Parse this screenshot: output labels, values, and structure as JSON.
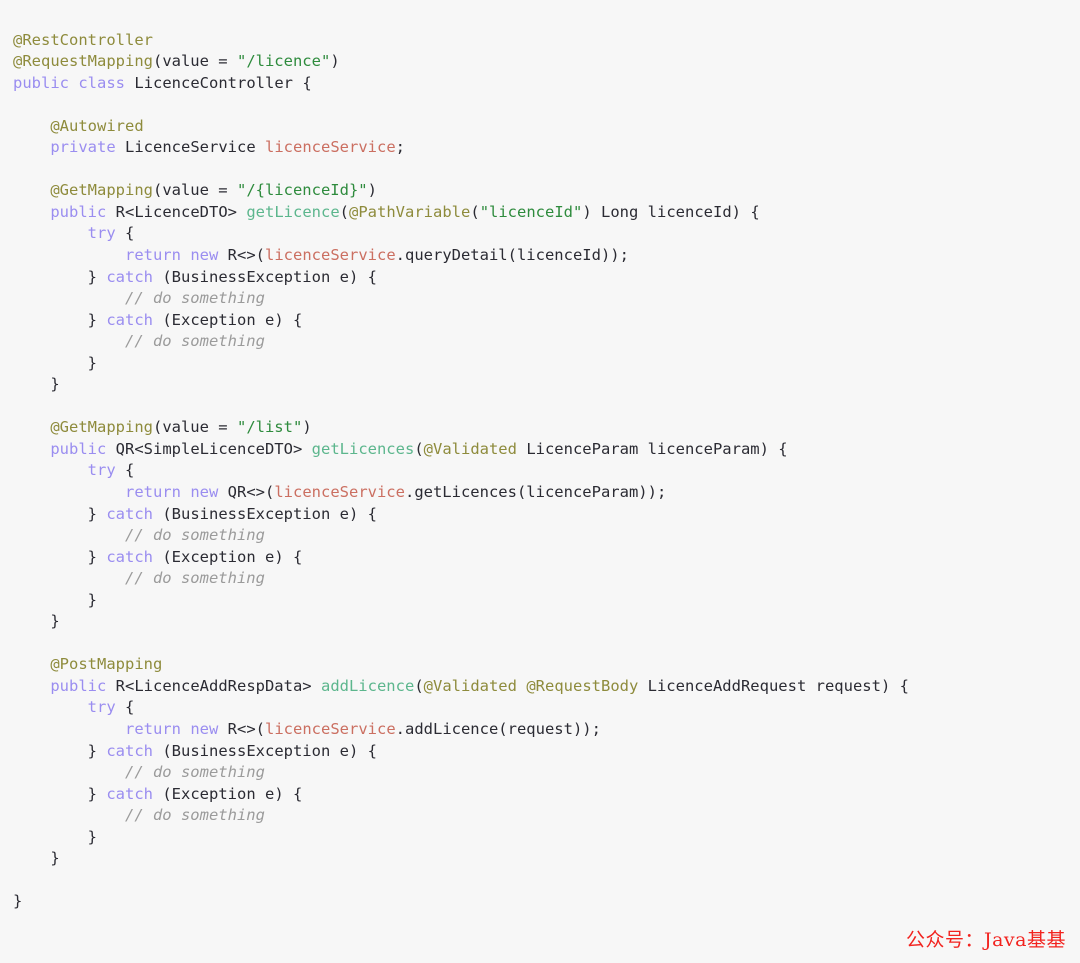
{
  "viewer": {
    "name": "java-code-snippet",
    "language": "Java",
    "background_color": "#f7f7f7",
    "default_text_color": "#2b2b33"
  },
  "theme": {
    "annotation_color": "#8e8b3c",
    "keyword_color": "#9a8df0",
    "string_color": "#2e8b3d",
    "field_color": "#cb6f61",
    "method_color": "#5cb68d",
    "class_color": "#2b2b33",
    "comment_color": "#9b9b9b",
    "watermark_color": "#f2231f"
  },
  "watermark": {
    "text": "公众号：Java基基"
  },
  "code": {
    "lines": [
      [
        {
          "t": "@RestController",
          "c": "ann"
        }
      ],
      [
        {
          "t": "@RequestMapping",
          "c": "ann"
        },
        {
          "t": "(value = ",
          "c": "pln"
        },
        {
          "t": "\"/licence\"",
          "c": "str"
        },
        {
          "t": ")",
          "c": "pln"
        }
      ],
      [
        {
          "t": "public",
          "c": "kw"
        },
        {
          "t": " ",
          "c": "pln"
        },
        {
          "t": "class",
          "c": "kw"
        },
        {
          "t": " ",
          "c": "pln"
        },
        {
          "t": "LicenceController",
          "c": "cls"
        },
        {
          "t": " {",
          "c": "pln"
        }
      ],
      [],
      [
        {
          "t": "    ",
          "c": "pln"
        },
        {
          "t": "@Autowired",
          "c": "ann"
        }
      ],
      [
        {
          "t": "    ",
          "c": "pln"
        },
        {
          "t": "private",
          "c": "kw"
        },
        {
          "t": " ",
          "c": "pln"
        },
        {
          "t": "LicenceService",
          "c": "cls"
        },
        {
          "t": " ",
          "c": "pln"
        },
        {
          "t": "licenceService",
          "c": "fld"
        },
        {
          "t": ";",
          "c": "pln"
        }
      ],
      [],
      [
        {
          "t": "    ",
          "c": "pln"
        },
        {
          "t": "@GetMapping",
          "c": "ann"
        },
        {
          "t": "(value = ",
          "c": "pln"
        },
        {
          "t": "\"/{licenceId}\"",
          "c": "str"
        },
        {
          "t": ")",
          "c": "pln"
        }
      ],
      [
        {
          "t": "    ",
          "c": "pln"
        },
        {
          "t": "public",
          "c": "kw"
        },
        {
          "t": " ",
          "c": "pln"
        },
        {
          "t": "R<LicenceDTO>",
          "c": "cls"
        },
        {
          "t": " ",
          "c": "pln"
        },
        {
          "t": "getLicence",
          "c": "mth"
        },
        {
          "t": "(",
          "c": "pln"
        },
        {
          "t": "@PathVariable",
          "c": "ann"
        },
        {
          "t": "(",
          "c": "pln"
        },
        {
          "t": "\"licenceId\"",
          "c": "str"
        },
        {
          "t": ") Long licenceId) {",
          "c": "pln"
        }
      ],
      [
        {
          "t": "        ",
          "c": "pln"
        },
        {
          "t": "try",
          "c": "kw"
        },
        {
          "t": " {",
          "c": "pln"
        }
      ],
      [
        {
          "t": "            ",
          "c": "pln"
        },
        {
          "t": "return",
          "c": "kw"
        },
        {
          "t": " ",
          "c": "pln"
        },
        {
          "t": "new",
          "c": "kw"
        },
        {
          "t": " R<>(",
          "c": "pln"
        },
        {
          "t": "licenceService",
          "c": "fld"
        },
        {
          "t": ".queryDetail(licenceId));",
          "c": "pln"
        }
      ],
      [
        {
          "t": "        } ",
          "c": "pln"
        },
        {
          "t": "catch",
          "c": "kw"
        },
        {
          "t": " (BusinessException e) {",
          "c": "pln"
        }
      ],
      [
        {
          "t": "            ",
          "c": "pln"
        },
        {
          "t": "// do something",
          "c": "cmt"
        }
      ],
      [
        {
          "t": "        } ",
          "c": "pln"
        },
        {
          "t": "catch",
          "c": "kw"
        },
        {
          "t": " (Exception e) {",
          "c": "pln"
        }
      ],
      [
        {
          "t": "            ",
          "c": "pln"
        },
        {
          "t": "// do something",
          "c": "cmt"
        }
      ],
      [
        {
          "t": "        }",
          "c": "pln"
        }
      ],
      [
        {
          "t": "    }",
          "c": "pln"
        }
      ],
      [],
      [
        {
          "t": "    ",
          "c": "pln"
        },
        {
          "t": "@GetMapping",
          "c": "ann"
        },
        {
          "t": "(value = ",
          "c": "pln"
        },
        {
          "t": "\"/list\"",
          "c": "str"
        },
        {
          "t": ")",
          "c": "pln"
        }
      ],
      [
        {
          "t": "    ",
          "c": "pln"
        },
        {
          "t": "public",
          "c": "kw"
        },
        {
          "t": " ",
          "c": "pln"
        },
        {
          "t": "QR<SimpleLicenceDTO>",
          "c": "cls"
        },
        {
          "t": " ",
          "c": "pln"
        },
        {
          "t": "getLicences",
          "c": "mth"
        },
        {
          "t": "(",
          "c": "pln"
        },
        {
          "t": "@Validated",
          "c": "ann"
        },
        {
          "t": " LicenceParam licenceParam) {",
          "c": "pln"
        }
      ],
      [
        {
          "t": "        ",
          "c": "pln"
        },
        {
          "t": "try",
          "c": "kw"
        },
        {
          "t": " {",
          "c": "pln"
        }
      ],
      [
        {
          "t": "            ",
          "c": "pln"
        },
        {
          "t": "return",
          "c": "kw"
        },
        {
          "t": " ",
          "c": "pln"
        },
        {
          "t": "new",
          "c": "kw"
        },
        {
          "t": " QR<>(",
          "c": "pln"
        },
        {
          "t": "licenceService",
          "c": "fld"
        },
        {
          "t": ".getLicences(licenceParam));",
          "c": "pln"
        }
      ],
      [
        {
          "t": "        } ",
          "c": "pln"
        },
        {
          "t": "catch",
          "c": "kw"
        },
        {
          "t": " (BusinessException e) {",
          "c": "pln"
        }
      ],
      [
        {
          "t": "            ",
          "c": "pln"
        },
        {
          "t": "// do something",
          "c": "cmt"
        }
      ],
      [
        {
          "t": "        } ",
          "c": "pln"
        },
        {
          "t": "catch",
          "c": "kw"
        },
        {
          "t": " (Exception e) {",
          "c": "pln"
        }
      ],
      [
        {
          "t": "            ",
          "c": "pln"
        },
        {
          "t": "// do something",
          "c": "cmt"
        }
      ],
      [
        {
          "t": "        }",
          "c": "pln"
        }
      ],
      [
        {
          "t": "    }",
          "c": "pln"
        }
      ],
      [],
      [
        {
          "t": "    ",
          "c": "pln"
        },
        {
          "t": "@PostMapping",
          "c": "ann"
        }
      ],
      [
        {
          "t": "    ",
          "c": "pln"
        },
        {
          "t": "public",
          "c": "kw"
        },
        {
          "t": " ",
          "c": "pln"
        },
        {
          "t": "R<LicenceAddRespData>",
          "c": "cls"
        },
        {
          "t": " ",
          "c": "pln"
        },
        {
          "t": "addLicence",
          "c": "mth"
        },
        {
          "t": "(",
          "c": "pln"
        },
        {
          "t": "@Validated",
          "c": "ann"
        },
        {
          "t": " ",
          "c": "pln"
        },
        {
          "t": "@RequestBody",
          "c": "ann"
        },
        {
          "t": " LicenceAddRequest request) {",
          "c": "pln"
        }
      ],
      [
        {
          "t": "        ",
          "c": "pln"
        },
        {
          "t": "try",
          "c": "kw"
        },
        {
          "t": " {",
          "c": "pln"
        }
      ],
      [
        {
          "t": "            ",
          "c": "pln"
        },
        {
          "t": "return",
          "c": "kw"
        },
        {
          "t": " ",
          "c": "pln"
        },
        {
          "t": "new",
          "c": "kw"
        },
        {
          "t": " R<>(",
          "c": "pln"
        },
        {
          "t": "licenceService",
          "c": "fld"
        },
        {
          "t": ".addLicence(request));",
          "c": "pln"
        }
      ],
      [
        {
          "t": "        } ",
          "c": "pln"
        },
        {
          "t": "catch",
          "c": "kw"
        },
        {
          "t": " (BusinessException e) {",
          "c": "pln"
        }
      ],
      [
        {
          "t": "            ",
          "c": "pln"
        },
        {
          "t": "// do something",
          "c": "cmt"
        }
      ],
      [
        {
          "t": "        } ",
          "c": "pln"
        },
        {
          "t": "catch",
          "c": "kw"
        },
        {
          "t": " (Exception e) {",
          "c": "pln"
        }
      ],
      [
        {
          "t": "            ",
          "c": "pln"
        },
        {
          "t": "// do something",
          "c": "cmt"
        }
      ],
      [
        {
          "t": "        }",
          "c": "pln"
        }
      ],
      [
        {
          "t": "    }",
          "c": "pln"
        }
      ],
      [],
      [
        {
          "t": "}",
          "c": "pln"
        }
      ]
    ]
  }
}
